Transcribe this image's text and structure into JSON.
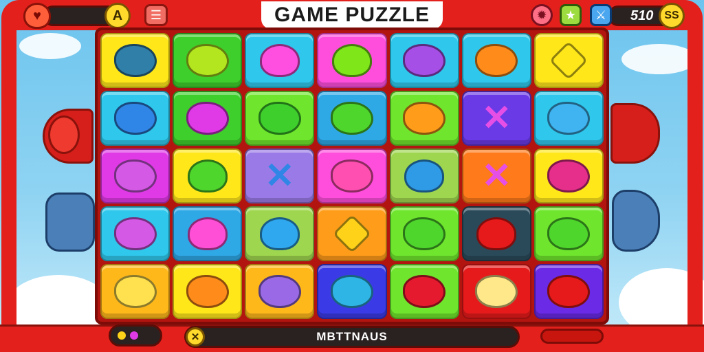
{
  "header": {
    "title": "GAME PUZZLE",
    "left_coin": "A",
    "score": "510",
    "right_coin": "SS"
  },
  "icons": {
    "heart_badge": "heart-icon",
    "menu": "menu-icon",
    "gear": "gear-icon",
    "star": "star-icon",
    "sword": "sword-icon",
    "close": "close-icon"
  },
  "footer": {
    "status_text": "MBTTNAUS",
    "close_symbol": "✕"
  },
  "board": {
    "rows": 5,
    "cols": 7,
    "tiles": [
      {
        "bg": "#ffe71a",
        "piece": "#2f7fa8",
        "shape": "blob"
      },
      {
        "bg": "#3fcf2d",
        "piece": "#b3e61e",
        "shape": "blob"
      },
      {
        "bg": "#2fc8ec",
        "piece": "#ff4fe0",
        "shape": "heart"
      },
      {
        "bg": "#ff4ddc",
        "piece": "#7fe61a",
        "shape": "heart"
      },
      {
        "bg": "#2fc8ec",
        "piece": "#a64fe6",
        "shape": "blob"
      },
      {
        "bg": "#2fc8ec",
        "piece": "#ff8c1a",
        "shape": "blob"
      },
      {
        "bg": "#ffe71a",
        "piece": "#ffe71a",
        "shape": "gem"
      },
      {
        "bg": "#2fc8ec",
        "piece": "#2f86e6",
        "shape": "blob"
      },
      {
        "bg": "#3fcf2d",
        "piece": "#e03ae6",
        "shape": "blob"
      },
      {
        "bg": "#6fe62d",
        "piece": "#3fcf2d",
        "shape": "blob"
      },
      {
        "bg": "#2fa8e6",
        "piece": "#4fd62d",
        "shape": "blob"
      },
      {
        "bg": "#6fe62d",
        "piece": "#ff9c1a",
        "shape": "blob"
      },
      {
        "bg": "#6a3ae6",
        "piece": "#e64fe6",
        "shape": "cross"
      },
      {
        "bg": "#2fc8ec",
        "piece": "#3fb4f0",
        "shape": "blob"
      },
      {
        "bg": "#e03ae6",
        "piece": "#d45ae6",
        "shape": "blob"
      },
      {
        "bg": "#ffe71a",
        "piece": "#4fd62d",
        "shape": "heart"
      },
      {
        "bg": "#9a7ae6",
        "piece": "#2f86e6",
        "shape": "cross"
      },
      {
        "bg": "#ff4ddc",
        "piece": "#ff4fb0",
        "shape": "blob"
      },
      {
        "bg": "#9fd64f",
        "piece": "#2f9ae6",
        "shape": "heart"
      },
      {
        "bg": "#ff7a1a",
        "piece": "#e64fe6",
        "shape": "cross"
      },
      {
        "bg": "#ffe71a",
        "piece": "#e62f8a",
        "shape": "blob"
      },
      {
        "bg": "#2fc8ec",
        "piece": "#d45ae6",
        "shape": "blob"
      },
      {
        "bg": "#2fa8e6",
        "piece": "#ff4fd6",
        "shape": "heart"
      },
      {
        "bg": "#9fd64f",
        "piece": "#2fa8f0",
        "shape": "heart"
      },
      {
        "bg": "#ff9c1a",
        "piece": "#ffd21a",
        "shape": "gem"
      },
      {
        "bg": "#6fe62d",
        "piece": "#4fd62d",
        "shape": "blob"
      },
      {
        "bg": "#2a4a5a",
        "piece": "#e61a1a",
        "shape": "heart"
      },
      {
        "bg": "#6fe62d",
        "piece": "#4fd62d",
        "shape": "blob"
      },
      {
        "bg": "#ffb81a",
        "piece": "#ffe04f",
        "shape": "blob"
      },
      {
        "bg": "#ffe71a",
        "piece": "#ff8c1a",
        "shape": "blob"
      },
      {
        "bg": "#ffb81a",
        "piece": "#9a6ae6",
        "shape": "blob"
      },
      {
        "bg": "#3a3ae6",
        "piece": "#2fb4e6",
        "shape": "blob"
      },
      {
        "bg": "#6fe62d",
        "piece": "#e61a2f",
        "shape": "blob"
      },
      {
        "bg": "#e61a1a",
        "piece": "#ffe88a",
        "shape": "blob"
      },
      {
        "bg": "#6a2ae6",
        "piece": "#e61a1a",
        "shape": "blob"
      }
    ]
  }
}
